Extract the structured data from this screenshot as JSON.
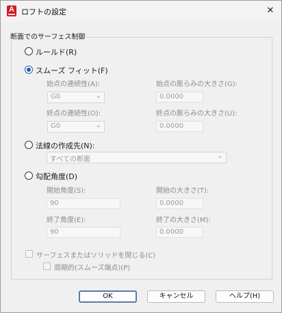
{
  "window": {
    "title": "ロフトの設定",
    "app_icon_letter": "A",
    "close_glyph": "✕"
  },
  "group": {
    "title": "断面でのサーフェス制御"
  },
  "options": {
    "ruled": {
      "label": "ルールド(R)",
      "checked": false
    },
    "smooth_fit": {
      "label": "スムーズ フィット(F)",
      "checked": true
    },
    "normal_to": {
      "label": "法線の作成先(N):",
      "checked": false
    },
    "draft_angle": {
      "label": "勾配角度(D)",
      "checked": false
    }
  },
  "smooth": {
    "start_continuity_label": "始点の連続性(A):",
    "start_continuity_value": "G0",
    "end_continuity_label": "終点の連続性(O):",
    "end_continuity_value": "G0",
    "start_bulge_label": "始点の膨らみの大きさ(G):",
    "start_bulge_value": "0.0000",
    "end_bulge_label": "終点の膨らみの大きさ(U):",
    "end_bulge_value": "0.0000"
  },
  "normal": {
    "select_value": "すべての断面"
  },
  "draft": {
    "start_angle_label": "開始角度(S):",
    "start_angle_value": "90",
    "start_magnitude_label": "開始の大きさ(T):",
    "start_magnitude_value": "0.0000",
    "end_angle_label": "終了角度(E):",
    "end_angle_value": "90",
    "end_magnitude_label": "終了の大きさ(M):",
    "end_magnitude_value": "0.0000"
  },
  "checks": {
    "close_surface": {
      "label": "サーフェスまたはソリッドを閉じる(C)",
      "checked": false
    },
    "periodic": {
      "label": "周期的(スムーズ端点)(P)",
      "checked": false
    }
  },
  "buttons": {
    "ok": "OK",
    "cancel": "キャンセル",
    "help": "ヘルプ(H)"
  },
  "colors": {
    "accent": "#1a5fb4",
    "app_icon": "#d01c22",
    "disabled_text": "#8c8c8c"
  },
  "icons": {
    "app": "autocad-app-icon",
    "close": "close-icon",
    "dropdown": "chevron-down-icon"
  }
}
